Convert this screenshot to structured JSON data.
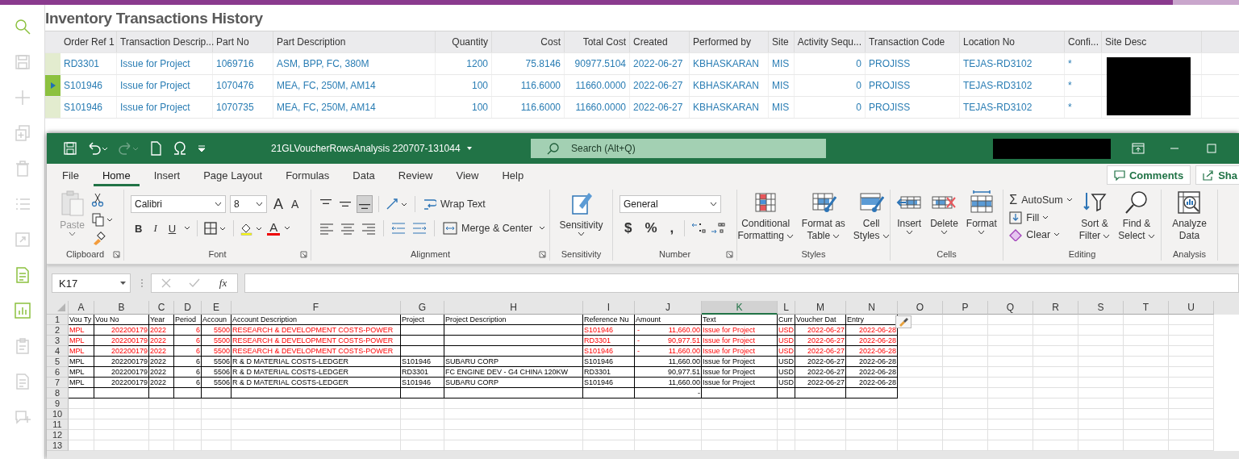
{
  "app": {
    "title": "Inventory Transactions History"
  },
  "sidebar": {
    "tools": [
      {
        "kind": "search",
        "disabled": false
      },
      {
        "kind": "save",
        "disabled": true
      },
      {
        "kind": "add",
        "disabled": true
      },
      {
        "kind": "copy",
        "disabled": true
      },
      {
        "kind": "delete",
        "disabled": true
      },
      {
        "kind": "list",
        "disabled": true
      },
      {
        "kind": "expand",
        "disabled": true
      },
      {
        "kind": "document",
        "disabled": false
      },
      {
        "kind": "chart",
        "disabled": false
      },
      {
        "kind": "clipboard",
        "disabled": true
      },
      {
        "kind": "document",
        "disabled": true
      },
      {
        "kind": "comment",
        "disabled": true
      }
    ]
  },
  "table": {
    "columns": [
      {
        "label": "Order Ref 1"
      },
      {
        "label": "Transaction Descrip..."
      },
      {
        "label": "Part No"
      },
      {
        "label": "Part Description"
      },
      {
        "label": "Quantity"
      },
      {
        "label": "Cost"
      },
      {
        "label": "Total Cost"
      },
      {
        "label": "Created"
      },
      {
        "label": "Performed by"
      },
      {
        "label": "Site"
      },
      {
        "label": "Activity Sequ..."
      },
      {
        "label": "Transaction Code"
      },
      {
        "label": "Location No"
      },
      {
        "label": "Confi..."
      },
      {
        "label": "Site Desc"
      }
    ],
    "rows": [
      {
        "selected": false,
        "cells": [
          "RD3301",
          "Issue for Project",
          "1069716",
          "ASM, BPP, FC, 380M",
          "1200",
          "75.8146",
          "90977.5104",
          "2022-06-27",
          "KBHASKARAN",
          "MIS",
          "0",
          "PROJISS",
          "TEJAS-RD3102",
          "*"
        ]
      },
      {
        "selected": true,
        "cells": [
          "S101946",
          "Issue for Project",
          "1070476",
          "MEA, FC, 250M, AM14",
          "100",
          "116.6000",
          "11660.0000",
          "2022-06-27",
          "KBHASKARAN",
          "MIS",
          "0",
          "PROJISS",
          "TEJAS-RD3102",
          "*"
        ]
      },
      {
        "selected": false,
        "cells": [
          "S101946",
          "Issue for Project",
          "1070735",
          "MEA, FC, 250M, AM14",
          "100",
          "116.6000",
          "11660.0000",
          "2022-06-27",
          "KBHASKARAN",
          "MIS",
          "0",
          "PROJISS",
          "TEJAS-RD3102",
          "*"
        ]
      }
    ]
  },
  "excel": {
    "title_bar": {
      "file_name": "21GLVoucherRowsAnalysis 220707-131044",
      "search_placeholder": "Search (Alt+Q)",
      "redo_disabled": true
    },
    "tabs": [
      {
        "label": "File",
        "selected": false
      },
      {
        "label": "Home",
        "selected": true
      },
      {
        "label": "Insert",
        "selected": false
      },
      {
        "label": "Page Layout",
        "selected": false
      },
      {
        "label": "Formulas",
        "selected": false
      },
      {
        "label": "Data",
        "selected": false
      },
      {
        "label": "Review",
        "selected": false
      },
      {
        "label": "View",
        "selected": false
      },
      {
        "label": "Help",
        "selected": false
      }
    ],
    "comments": "Comments",
    "share": "Sha",
    "ribbon": {
      "clipboard": {
        "label": "Clipboard",
        "paste": {
          "label": "Paste",
          "disabled": true
        }
      },
      "font": {
        "label": "Font",
        "name": "Calibri",
        "size": "8",
        "grow": "A",
        "shrink": "A",
        "styles": [
          "B",
          "I",
          "U"
        ],
        "color_letter": "A"
      },
      "alignment": {
        "label": "Alignment",
        "vertical": [
          {
            "selected": false
          },
          {
            "selected": false
          },
          {
            "selected": true
          }
        ],
        "wrap": "Wrap Text",
        "merge": "Merge & Center"
      },
      "sensitivity": {
        "label": "Sensitivity",
        "button": "Sensitivity"
      },
      "number": {
        "label": "Number",
        "format": "General",
        "symbols": [
          "$",
          "%",
          ","
        ]
      },
      "styles": {
        "label": "Styles",
        "buttons": [
          {
            "kind": "conditional",
            "lines": [
              "Conditional",
              "Formatting"
            ],
            "menu": true
          },
          {
            "kind": "table",
            "lines": [
              "Format as",
              "Table"
            ],
            "menu": true
          },
          {
            "kind": "cellstyles",
            "lines": [
              "Cell",
              "Styles"
            ],
            "menu": true
          }
        ]
      },
      "cells": {
        "label": "Cells",
        "buttons": [
          {
            "kind": "insert",
            "lines": [
              "Insert"
            ],
            "menu": true
          },
          {
            "kind": "delete",
            "lines": [
              "Delete"
            ],
            "menu": true
          },
          {
            "kind": "format",
            "lines": [
              "Format"
            ],
            "menu": true
          }
        ]
      },
      "editing": {
        "label": "Editing",
        "autosum_symbol": "Σ",
        "autosum": "AutoSum",
        "fill": "Fill",
        "clear": "Clear",
        "buttons": [
          {
            "kind": "sort",
            "lines": [
              "Sort &",
              "Filter"
            ],
            "menu": true
          },
          {
            "kind": "find",
            "lines": [
              "Find &",
              "Select"
            ],
            "menu": true
          }
        ]
      },
      "analysis": {
        "label": "Analysis",
        "buttons": [
          {
            "kind": "analyze",
            "lines": [
              "Analyze",
              "Data"
            ],
            "menu": false
          }
        ]
      }
    },
    "formula_bar": {
      "name_box": "K17",
      "fx": "fx"
    },
    "sheet": {
      "columns": [
        {
          "letter": "A",
          "selected": false
        },
        {
          "letter": "B",
          "selected": false
        },
        {
          "letter": "C",
          "selected": false
        },
        {
          "letter": "D",
          "selected": false
        },
        {
          "letter": "E",
          "selected": false
        },
        {
          "letter": "F",
          "selected": false
        },
        {
          "letter": "G",
          "selected": false
        },
        {
          "letter": "H",
          "selected": false
        },
        {
          "letter": "I",
          "selected": false
        },
        {
          "letter": "J",
          "selected": false
        },
        {
          "letter": "K",
          "selected": true
        },
        {
          "letter": "L",
          "selected": false
        },
        {
          "letter": "M",
          "selected": false
        },
        {
          "letter": "N",
          "selected": false
        },
        {
          "letter": "O",
          "selected": false
        },
        {
          "letter": "P",
          "selected": false
        },
        {
          "letter": "Q",
          "selected": false
        },
        {
          "letter": "R",
          "selected": false
        },
        {
          "letter": "S",
          "selected": false
        },
        {
          "letter": "T",
          "selected": false
        },
        {
          "letter": "U",
          "selected": false
        }
      ],
      "rows": [
        {
          "number": "1",
          "kind": "header",
          "boxed": true,
          "highlighted": false,
          "cells": {
            "A": "Vou Ty",
            "B": "Vou No",
            "C": "Year",
            "D": "Period",
            "E": "Accoun",
            "F": "Account Description",
            "G": "Project",
            "H": "Project Description",
            "I": "Reference Nu",
            "J": "Amount",
            "K": "Text",
            "L": "Curr",
            "M": "Voucher Dat",
            "N": "Entry"
          }
        },
        {
          "number": "2",
          "kind": "data",
          "boxed": true,
          "highlighted": true,
          "amount_sign": "-",
          "cells": {
            "A": "MPL",
            "B": "202200179",
            "C": "2022",
            "D": "6",
            "E": "5500",
            "F": "RESEARCH & DEVELOPMENT COSTS-POWER",
            "I": "S101946",
            "J": "11,660.00",
            "K": "Issue for Project",
            "L": "USD",
            "M": "2022-06-27",
            "N": "2022-06-28"
          }
        },
        {
          "number": "3",
          "kind": "data",
          "boxed": true,
          "highlighted": true,
          "amount_sign": "-",
          "cells": {
            "A": "MPL",
            "B": "202200179",
            "C": "2022",
            "D": "6",
            "E": "5500",
            "F": "RESEARCH & DEVELOPMENT COSTS-POWER",
            "I": "RD3301",
            "J": "90,977.51",
            "K": "Issue for Project",
            "L": "USD",
            "M": "2022-06-27",
            "N": "2022-06-28"
          }
        },
        {
          "number": "4",
          "kind": "data",
          "boxed": true,
          "highlighted": true,
          "amount_sign": "-",
          "cells": {
            "A": "MPL",
            "B": "202200179",
            "C": "2022",
            "D": "6",
            "E": "5500",
            "F": "RESEARCH & DEVELOPMENT COSTS-POWER",
            "I": "S101946",
            "J": "11,660.00",
            "K": "Issue for Project",
            "L": "USD",
            "M": "2022-06-27",
            "N": "2022-06-28"
          }
        },
        {
          "number": "5",
          "kind": "data",
          "boxed": true,
          "highlighted": false,
          "cells": {
            "A": "MPL",
            "B": "202200179",
            "C": "2022",
            "D": "6",
            "E": "5506",
            "F": "R & D MATERIAL COSTS-LEDGER",
            "G": "S101946",
            "H": "SUBARU CORP",
            "I": "S101946",
            "J": "11,660.00",
            "K": "Issue for Project",
            "L": "USD",
            "M": "2022-06-27",
            "N": "2022-06-28"
          }
        },
        {
          "number": "6",
          "kind": "data",
          "boxed": true,
          "highlighted": false,
          "cells": {
            "A": "MPL",
            "B": "202200179",
            "C": "2022",
            "D": "6",
            "E": "5506",
            "F": "R & D MATERIAL COSTS-LEDGER",
            "G": "RD3301",
            "H": "FC ENGINE DEV - G4 CHINA 120KW",
            "I": "RD3301",
            "J": "90,977.51",
            "K": "Issue for Project",
            "L": "USD",
            "M": "2022-06-27",
            "N": "2022-06-28"
          }
        },
        {
          "number": "7",
          "kind": "data",
          "boxed": true,
          "highlighted": false,
          "cells": {
            "A": "MPL",
            "B": "202200179",
            "C": "2022",
            "D": "6",
            "E": "5506",
            "F": "R & D MATERIAL COSTS-LEDGER",
            "G": "S101946",
            "H": "SUBARU CORP",
            "I": "S101946",
            "J": "11,660.00",
            "K": "Issue for Project",
            "L": "USD",
            "M": "2022-06-27",
            "N": "2022-06-28"
          }
        },
        {
          "number": "8",
          "kind": "data",
          "boxed": true,
          "highlighted": false,
          "cells": {
            "J": "-"
          }
        },
        {
          "number": "9",
          "kind": "data",
          "boxed": false
        },
        {
          "number": "10",
          "kind": "data",
          "boxed": false
        },
        {
          "number": "11",
          "kind": "data",
          "boxed": false
        },
        {
          "number": "12",
          "kind": "data",
          "boxed": false
        },
        {
          "number": "13",
          "kind": "data",
          "boxed": false
        }
      ]
    }
  }
}
